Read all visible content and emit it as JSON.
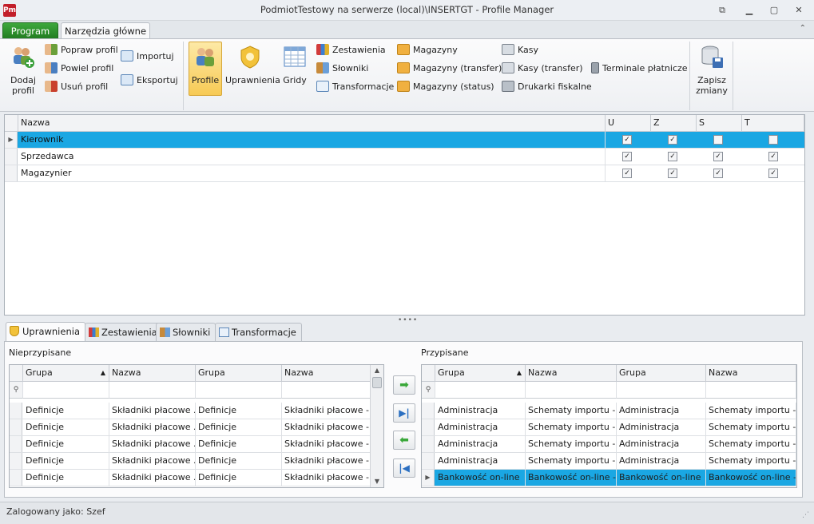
{
  "window": {
    "title": "PodmiotTestowy na serwerze (local)\\INSERTGT - Profile Manager",
    "logo_text": "Pm",
    "controls": [
      "restore-down-icon",
      "minimize-icon",
      "maximize-icon",
      "close-icon"
    ]
  },
  "ribbon_tabs": {
    "program": "Program",
    "narzedzia": "Narzędzia główne"
  },
  "ribbon": {
    "dodaj_profil": "Dodaj profil",
    "popraw_profil": "Popraw profil",
    "powiel_profil": "Powiel profil",
    "usun_profil": "Usuń profil",
    "importuj": "Importuj",
    "eksportuj": "Eksportuj",
    "profile": "Profile",
    "uprawnienia": "Uprawnienia",
    "gridy": "Gridy",
    "zestawienia": "Zestawienia",
    "slowniki": "Słowniki",
    "transformacje": "Transformacje",
    "magazyny": "Magazyny",
    "magazyny_transfer": "Magazyny (transfer)",
    "magazyny_status": "Magazyny (status)",
    "kasy": "Kasy",
    "kasy_transfer": "Kasy (transfer)",
    "drukarki_fiskalne": "Drukarki fiskalne",
    "terminale_platnicze": "Terminale płatnicze",
    "zapisz_zmiany": "Zapisz zmiany"
  },
  "profiles_grid": {
    "columns": {
      "nazwa": "Nazwa",
      "u": "U",
      "z": "Z",
      "s": "S",
      "t": "T"
    },
    "rows": [
      {
        "nazwa": "Kierownik",
        "u": true,
        "z": true,
        "s": false,
        "t": false,
        "selected": true
      },
      {
        "nazwa": "Sprzedawca",
        "u": true,
        "z": true,
        "s": true,
        "t": true,
        "selected": false
      },
      {
        "nazwa": "Magazynier",
        "u": true,
        "z": true,
        "s": true,
        "t": true,
        "selected": false
      }
    ]
  },
  "bottom_tabs": {
    "uprawnienia": "Uprawnienia",
    "zestawienia": "Zestawienia",
    "slowniki": "Słowniki",
    "transformacje": "Transformacje"
  },
  "unassigned": {
    "label": "Nieprzypisane",
    "columns": [
      "Grupa",
      "Nazwa",
      "Grupa",
      "Nazwa"
    ],
    "rows": [
      [
        "Definicje",
        "Składniki płacowe ...",
        "Definicje",
        "Składniki płacowe -..."
      ],
      [
        "Definicje",
        "Składniki płacowe ...",
        "Definicje",
        "Składniki płacowe -..."
      ],
      [
        "Definicje",
        "Składniki płacowe ...",
        "Definicje",
        "Składniki płacowe -..."
      ],
      [
        "Definicje",
        "Składniki płacowe ...",
        "Definicje",
        "Składniki płacowe -..."
      ],
      [
        "Definicje",
        "Składniki płacowe ...",
        "Definicje",
        "Składniki płacowe -..."
      ]
    ]
  },
  "assigned": {
    "label": "Przypisane",
    "columns": [
      "Grupa",
      "Nazwa",
      "Grupa",
      "Nazwa"
    ],
    "rows": [
      [
        "Administracja",
        "Schematy importu -...",
        "Administracja",
        "Schematy importu -..."
      ],
      [
        "Administracja",
        "Schematy importu -...",
        "Administracja",
        "Schematy importu -..."
      ],
      [
        "Administracja",
        "Schematy importu -...",
        "Administracja",
        "Schematy importu -..."
      ],
      [
        "Administracja",
        "Schematy importu -...",
        "Administracja",
        "Schematy importu -..."
      ],
      [
        "Bankowość on-line",
        "Bankowość on-line -...",
        "Bankowość on-line",
        "Bankowość on-line -..."
      ]
    ],
    "selected_row": 4
  },
  "move_buttons": [
    "arrow-right-icon",
    "move-all-right-icon",
    "arrow-left-icon",
    "move-all-left-icon"
  ],
  "status": {
    "logged_in": "Zalogowany jako: Szef"
  },
  "colors": {
    "selection": "#1aa7e3",
    "program_tab": "#2e8f2e",
    "active_button": "#f7ca55"
  }
}
